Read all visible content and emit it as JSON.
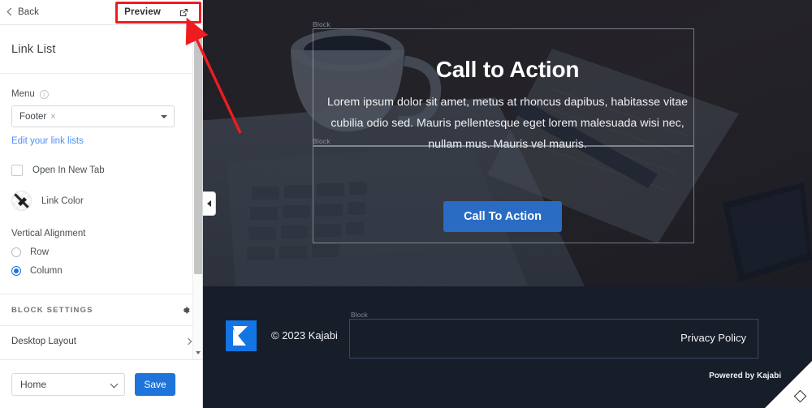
{
  "sidebar": {
    "topbar": {
      "back_label": "Back",
      "back_icon": "chevron-left-icon",
      "preview_label": "Preview",
      "preview_icon": "external-link-icon"
    },
    "panel_title": "Link List",
    "menu_field": {
      "label": "Menu",
      "info_icon": "info-icon",
      "selected_value": "Footer",
      "remove_tag": "×",
      "caret_icon": "caret-down-icon"
    },
    "edit_link": "Edit your link lists",
    "open_new_tab": {
      "label": "Open In New Tab",
      "checked": false
    },
    "link_color": {
      "label": "Link Color",
      "swatch_icon": "no-color-swatch-icon"
    },
    "vertical_alignment": {
      "label": "Vertical Alignment",
      "options": [
        {
          "label": "Row",
          "selected": false
        },
        {
          "label": "Column",
          "selected": true
        }
      ]
    },
    "block_settings": {
      "heading": "BLOCK SETTINGS",
      "gear_icon": "gear-icon"
    },
    "rows": [
      {
        "label": "Desktop Layout",
        "chevron_icon": "chevron-right-icon"
      }
    ],
    "footer": {
      "page_selected": "Home",
      "page_caret_icon": "chevron-down-icon",
      "save_label": "Save"
    },
    "scrollbar": {
      "name": "sidebar-scrollbar",
      "down_arrow_icon": "scroll-down-arrow-icon"
    }
  },
  "preview": {
    "collapse_handle_icon": "collapse-left-icon",
    "block_label": "Block",
    "hero": {
      "heading": "Call to Action",
      "paragraph": "Lorem ipsum dolor sit amet, metus at rhoncus dapibus, habitasse vitae cubilia odio sed. Mauris pellentesque eget lorem malesuada wisi nec, nullam mus. Mauris vel mauris.",
      "button_label": "Call To Action",
      "background_description": "desk-photo-laptop-coffee-notebook"
    },
    "site_footer": {
      "logo_icon": "kajabi-logo-icon",
      "copyright": "© 2023 Kajabi",
      "block_label": "Block",
      "privacy_link": "Privacy Policy",
      "powered_by": "Powered by Kajabi"
    },
    "resize_handle_icon": "resize-diamond-icon"
  },
  "annotation": {
    "type": "red-highlight-and-arrow",
    "target": "Preview"
  },
  "colors": {
    "accent_blue": "#1e74d8",
    "cta_button_blue": "#2a6cc4",
    "link_blue": "#4f8ff0",
    "annotation_red": "#ee1c20",
    "preview_dark": "#181d2a",
    "kajabi_logo_blue": "#1275e3"
  }
}
